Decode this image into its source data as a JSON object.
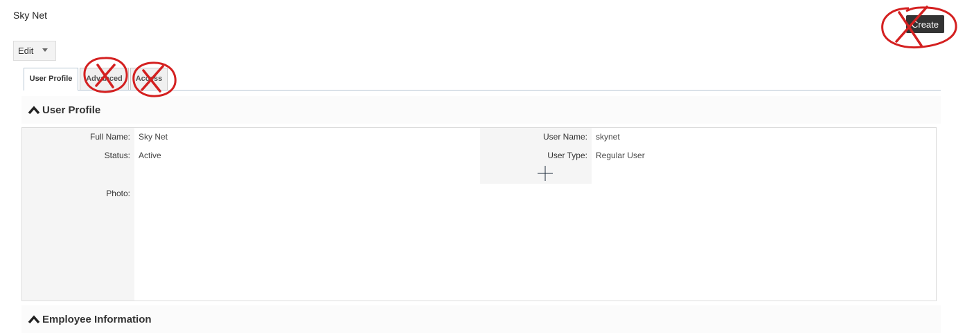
{
  "header": {
    "title": "Sky Net",
    "create_label": "Create"
  },
  "toolbar": {
    "edit_label": "Edit"
  },
  "tabs": [
    {
      "label": "User Profile",
      "active": true
    },
    {
      "label": "Advanced",
      "active": false
    },
    {
      "label": "Access",
      "active": false
    }
  ],
  "user_profile": {
    "heading": "User Profile",
    "fields": {
      "full_name": {
        "label": "Full Name:",
        "value": "Sky Net"
      },
      "status": {
        "label": "Status:",
        "value": "Active"
      },
      "photo": {
        "label": "Photo:"
      },
      "user_name": {
        "label": "User Name:",
        "value": "skynet"
      },
      "user_type": {
        "label": "User Type:",
        "value": "Regular User"
      }
    }
  },
  "employee_info": {
    "heading": "Employee Information"
  },
  "colors": {
    "annotation": "#d42020",
    "primary_button": "#333333"
  }
}
